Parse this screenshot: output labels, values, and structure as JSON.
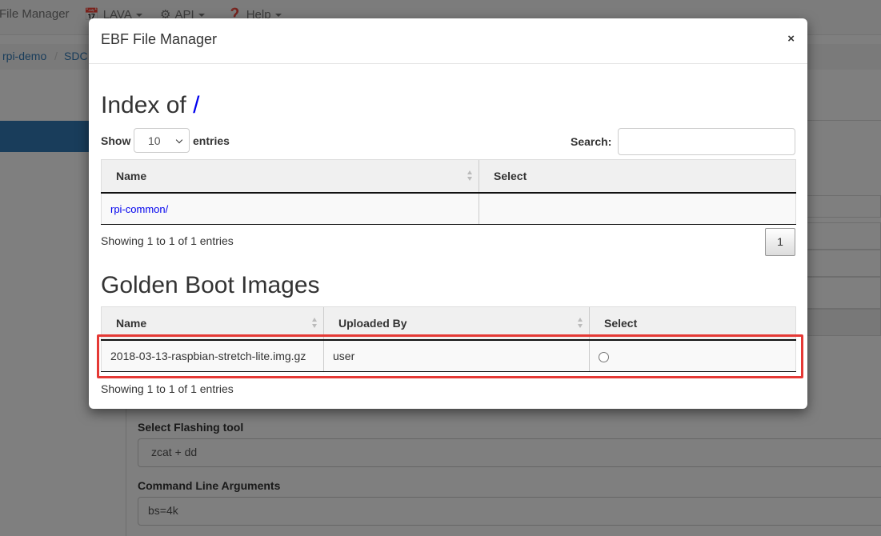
{
  "navbar": {
    "file_manager": "File Manager",
    "lava": "LAVA",
    "api": "API",
    "help": "Help"
  },
  "breadcrumb": [
    "rpi-demo",
    "SDC"
  ],
  "background_form": {
    "flashing_tool_label": "Select Flashing tool",
    "flashing_tool_value": "zcat + dd",
    "cmd_args_label": "Command Line Arguments",
    "cmd_args_value": "bs=4k"
  },
  "modal": {
    "title": "EBF File Manager",
    "close": "×",
    "index_section": {
      "heading_prefix": "Index of ",
      "heading_link": "/",
      "show_label": "Show",
      "length_value": "10",
      "entries_label": "entries",
      "search_label": "Search:",
      "search_value": "",
      "columns": [
        "Name",
        "Select"
      ],
      "rows": [
        {
          "name": "rpi-common/",
          "select": ""
        }
      ],
      "info": "Showing 1 to 1 of 1 entries",
      "page": "1"
    },
    "golden_section": {
      "heading": "Golden Boot Images",
      "columns": [
        "Name",
        "Uploaded By",
        "Select"
      ],
      "rows": [
        {
          "name": "2018-03-13-raspbian-stretch-lite.img.gz",
          "uploaded_by": "user",
          "selected": false
        }
      ],
      "info": "Showing 1 to 1 of 1 entries"
    }
  },
  "colors": {
    "highlight": "#e53935",
    "link": "#0000ee",
    "bootstrap_blue": "#337ab7"
  }
}
